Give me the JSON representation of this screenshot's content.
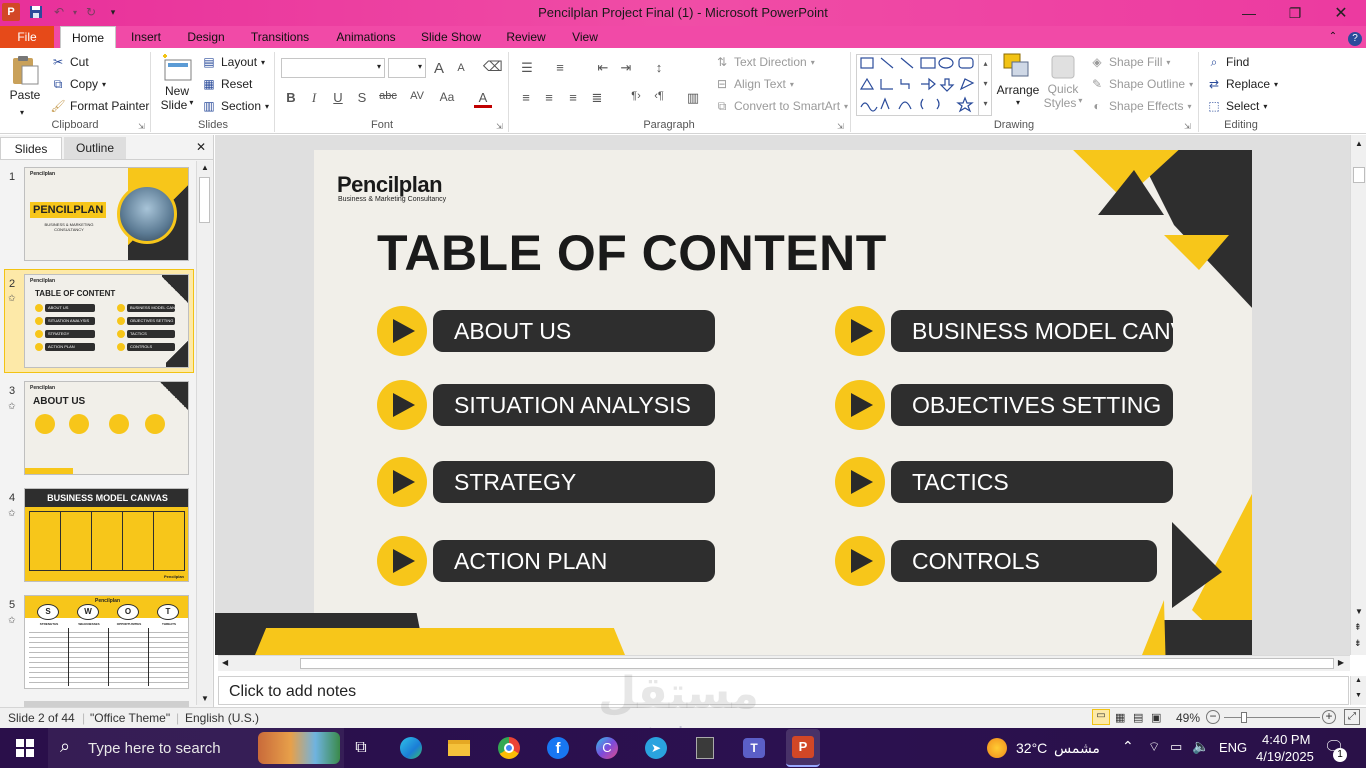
{
  "window": {
    "title": "Pencilplan Project Final (1)  -  Microsoft PowerPoint",
    "controls": [
      "minimize",
      "restore",
      "close"
    ]
  },
  "tabs": [
    "File",
    "Home",
    "Insert",
    "Design",
    "Transitions",
    "Animations",
    "Slide Show",
    "Review",
    "View"
  ],
  "active_tab": "Home",
  "ribbon": {
    "clipboard": {
      "label": "Clipboard",
      "paste": "Paste",
      "cut": "Cut",
      "copy": "Copy",
      "format_painter": "Format Painter"
    },
    "slides": {
      "label": "Slides",
      "new_slide_1": "New",
      "new_slide_2": "Slide",
      "layout": "Layout",
      "reset": "Reset",
      "section": "Section"
    },
    "font": {
      "label": "Font",
      "bold": "B",
      "italic": "I",
      "underline": "U",
      "shadow": "S",
      "strike": "abc",
      "spacing": "AV",
      "case": "Aa",
      "color": "A",
      "grow": "A",
      "shrink": "A"
    },
    "paragraph": {
      "label": "Paragraph",
      "text_direction": "Text Direction",
      "align_text": "Align Text",
      "smartart": "Convert to SmartArt"
    },
    "drawing": {
      "label": "Drawing",
      "arrange": "Arrange",
      "quick_styles_1": "Quick",
      "quick_styles_2": "Styles",
      "shape_fill": "Shape Fill",
      "shape_outline": "Shape Outline",
      "shape_effects": "Shape Effects"
    },
    "editing": {
      "label": "Editing",
      "find": "Find",
      "replace": "Replace",
      "select": "Select"
    }
  },
  "left_panel": {
    "tabs": [
      "Slides",
      "Outline"
    ],
    "thumbnails": [
      {
        "num": "1",
        "logo": "Pencilplan",
        "title": "PENCILPLAN",
        "sub": "BUSINESS & MARKETING CONSULTANCY"
      },
      {
        "num": "2",
        "logo": "Pencilplan",
        "title": "TABLE OF CONTENT",
        "items_left": [
          "ABOUT US",
          "SITUATION ANALYSIS",
          "STRATEGY",
          "ACTION PLAN"
        ],
        "items_right": [
          "BUSINESS MODEL CANVAS",
          "OBJECTIVES SETTING",
          "TACTICS",
          "CONTROLS"
        ]
      },
      {
        "num": "3",
        "logo": "Pencilplan",
        "title": "ABOUT US"
      },
      {
        "num": "4",
        "title": "BUSINESS MODEL CANVAS",
        "footer": "Pencilplan"
      },
      {
        "num": "5",
        "logo": "Pencilplan",
        "letters": [
          "S",
          "W",
          "O",
          "T"
        ],
        "labels": [
          "STRENGTHS",
          "WEAKNESSES",
          "OPPORTUNITIES",
          "THREATS"
        ]
      }
    ]
  },
  "slide": {
    "logo": "Pencilplan",
    "tagline": "Business & Marketing Consultancy",
    "heading": "TABLE OF CONTENT",
    "items_left": [
      "ABOUT US",
      "SITUATION ANALYSIS",
      "STRATEGY",
      "ACTION PLAN"
    ],
    "items_right": [
      "BUSINESS MODEL CANVAS",
      "OBJECTIVES SETTING",
      "TACTICS",
      "CONTROLS"
    ],
    "colors": {
      "accent": "#f7c61a",
      "dark": "#2e2e2e",
      "background": "#f1efe9"
    }
  },
  "notes_placeholder": "Click to add notes",
  "status": {
    "slide_info": "Slide 2 of 44",
    "theme": "\"Office Theme\"",
    "language": "English (U.S.)",
    "zoom": "49%"
  },
  "taskbar": {
    "search_placeholder": "Type here to search",
    "temperature": "32°C",
    "weather_label": "مشمس",
    "language": "ENG",
    "time": "4:40 PM",
    "date": "4/19/2025",
    "notification_count": "1",
    "watermark": "مستقل",
    "watermark_url": "mostaql.com"
  }
}
